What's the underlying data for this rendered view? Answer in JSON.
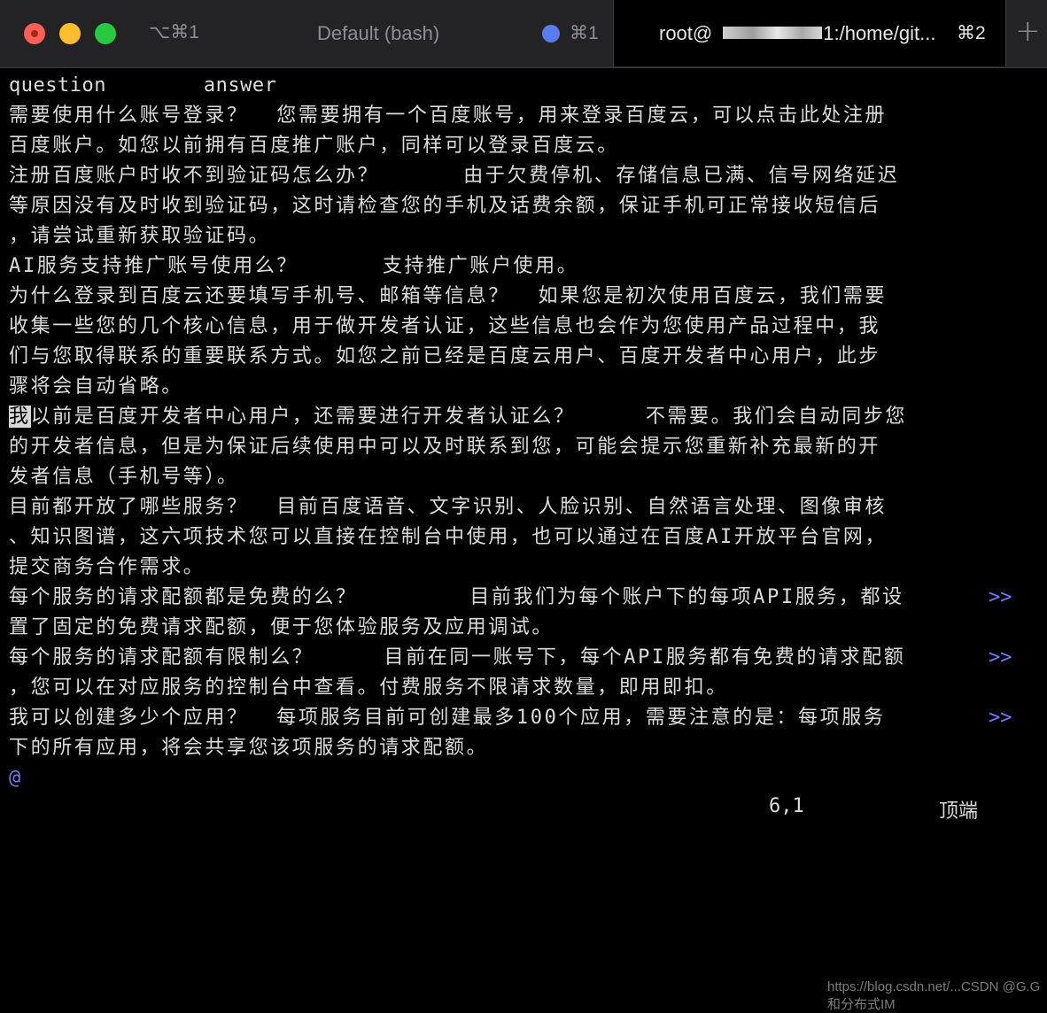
{
  "window": {
    "tab_bar": {
      "left_shortcut": "⌥⌘1",
      "default_tab": {
        "title": "Default (bash)",
        "shortcut": "⌘1"
      },
      "active_tab": {
        "title_prefix": "root@",
        "title_suffix": "1:/home/git...",
        "shortcut": "⌘2"
      },
      "new_tab_label": "+"
    }
  },
  "terminal": {
    "lines": [
      {
        "text": "question        answer"
      },
      {
        "text": "需要使用什么账号登录？  您需要拥有一个百度账号，用来登录百度云，可以点击此处注册"
      },
      {
        "text": "百度账户。如您以前拥有百度推广账户，同样可以登录百度云。"
      },
      {
        "text": "注册百度账户时收不到验证码怎么办？      由于欠费停机、存储信息已满、信号网络延迟"
      },
      {
        "text": "等原因没有及时收到验证码，这时请检查您的手机及话费余额，保证手机可正常接收短信后"
      },
      {
        "text": "，请尝试重新获取验证码。"
      },
      {
        "text": "AI服务支持推广账号使用么？      支持推广账户使用。"
      },
      {
        "text": "为什么登录到百度云还要填写手机号、邮箱等信息？  如果您是初次使用百度云，我们需要"
      },
      {
        "text": "收集一些您的几个核心信息，用于做开发者认证，这些信息也会作为您使用产品过程中，我"
      },
      {
        "text": "们与您取得联系的重要联系方式。如您之前已经是百度云用户、百度开发者中心用户，此步"
      },
      {
        "text": "骤将会自动省略。"
      },
      {
        "cursor_char": "我",
        "text": "以前是百度开发者中心用户，还需要进行开发者认证么？     不需要。我们会自动同步您"
      },
      {
        "text": "的开发者信息，但是为保证后续使用中可以及时联系到您，可能会提示您重新补充最新的开"
      },
      {
        "text": "发者信息（手机号等）。"
      },
      {
        "text": "目前都开放了哪些服务？  目前百度语音、文字识别、人脸识别、自然语言处理、图像审核"
      },
      {
        "text": "、知识图谱，这六项技术您可以直接在控制台中使用，也可以通过在百度AI开放平台官网，"
      },
      {
        "text": "提交商务合作需求。"
      },
      {
        "text": "每个服务的请求配额都是免费的么？        目前我们为每个账户下的每项API服务，都设",
        "marker": ">>"
      },
      {
        "text": "置了固定的免费请求配额，便于您体验服务及应用调试。"
      },
      {
        "text": "每个服务的请求配额有限制么？     目前在同一账号下，每个API服务都有免费的请求配额",
        "marker": ">>"
      },
      {
        "text": "，您可以在对应服务的控制台中查看。付费服务不限请求数量，即用即扣。"
      },
      {
        "text": "我可以创建多少个应用？  每项服务目前可创建最多100个应用，需要注意的是：每项服务",
        "marker": ">>"
      },
      {
        "text": "下的所有应用，将会共享您该项服务的请求配额。"
      },
      {
        "text": "@",
        "is_marker_line": true
      }
    ],
    "status": {
      "position": "6,1",
      "scroll": "顶端"
    }
  },
  "watermark": "https://blog.csdn.net/...CSDN @G.G和分布式IM"
}
